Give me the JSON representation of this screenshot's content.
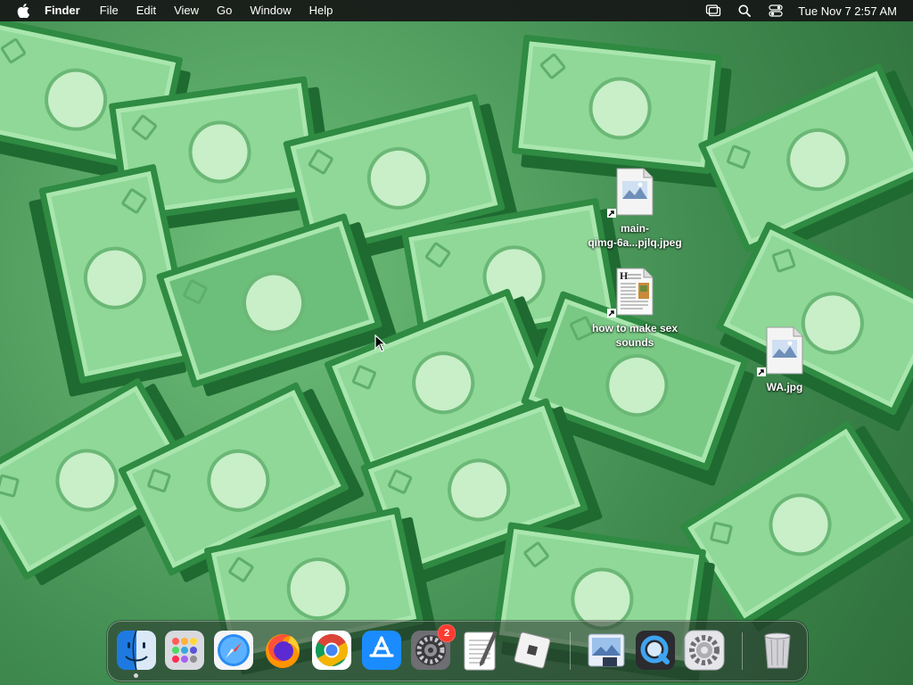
{
  "menubar": {
    "app_name": "Finder",
    "menus": [
      "File",
      "Edit",
      "View",
      "Go",
      "Window",
      "Help"
    ],
    "clock": "Tue Nov 7  2:57 AM",
    "status_icons": [
      "stage-manager-icon",
      "spotlight-search-icon",
      "control-center-icon"
    ]
  },
  "desktop": {
    "icons": [
      {
        "label": "main-\nqimg-6a...pjlq.jpeg",
        "type_tag": "JPEG",
        "kind": "image-alias"
      },
      {
        "label": "how to make sex sounds",
        "type_tag": "H",
        "kind": "document-alias"
      },
      {
        "label": "WA.jpg",
        "type_tag": "JPG",
        "kind": "image-alias"
      }
    ]
  },
  "dock": {
    "apps": [
      {
        "name": "Finder",
        "icon": "finder-icon",
        "running": true
      },
      {
        "name": "Launchpad",
        "icon": "launchpad-icon",
        "running": false
      },
      {
        "name": "Safari",
        "icon": "safari-icon",
        "running": false
      },
      {
        "name": "Firefox",
        "icon": "firefox-icon",
        "running": false
      },
      {
        "name": "Google Chrome",
        "icon": "chrome-icon",
        "running": false
      },
      {
        "name": "App Store",
        "icon": "app-store-icon",
        "running": false
      },
      {
        "name": "System Preferences",
        "icon": "system-preferences-icon",
        "running": false,
        "badge": "2"
      },
      {
        "name": "TextEdit",
        "icon": "textedit-icon",
        "running": false
      },
      {
        "name": "Roblox",
        "icon": "roblox-icon",
        "running": false
      },
      {
        "name": "Preview",
        "icon": "preview-icon",
        "running": false
      },
      {
        "name": "QuickTime Player",
        "icon": "quicktime-icon",
        "running": false
      },
      {
        "name": "System Settings",
        "icon": "system-settings-icon",
        "running": false
      },
      {
        "name": "Trash",
        "icon": "trash-icon",
        "running": false
      }
    ]
  }
}
